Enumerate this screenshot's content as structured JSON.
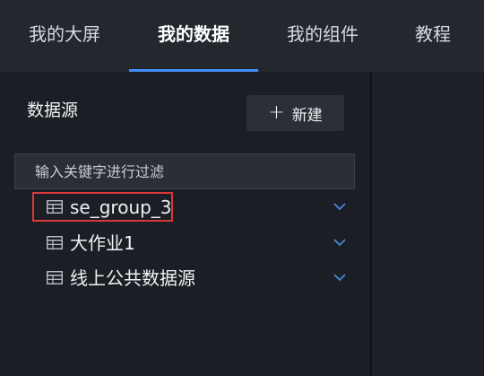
{
  "nav": {
    "tabs": [
      {
        "label": "我的大屏",
        "active": false
      },
      {
        "label": "我的数据",
        "active": true
      },
      {
        "label": "我的组件",
        "active": false
      },
      {
        "label": "教程",
        "active": false
      }
    ]
  },
  "sidebar": {
    "title": "数据源",
    "new_button": {
      "icon": "plus-icon",
      "label": "新建"
    },
    "search": {
      "placeholder": "输入关键字进行过滤",
      "value": ""
    },
    "items": [
      {
        "label": "se_group_3",
        "icon": "table-icon",
        "selected": true
      },
      {
        "label": "大作业1",
        "icon": "table-icon",
        "selected": false
      },
      {
        "label": "线上公共数据源",
        "icon": "table-icon",
        "selected": false
      }
    ]
  },
  "colors": {
    "accent": "#3f8ef5",
    "selection_outline": "#d83a3a",
    "chevron": "#4a8fe8"
  }
}
